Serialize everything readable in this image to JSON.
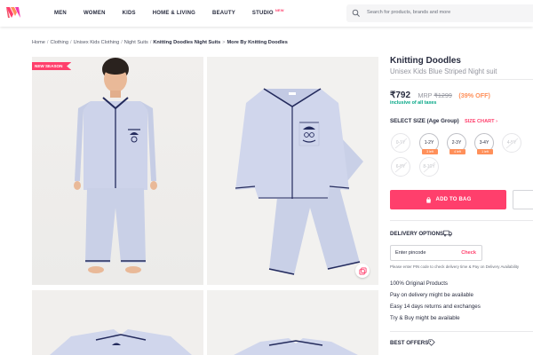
{
  "header": {
    "logo": "myntra-logo",
    "nav": [
      {
        "label": "MEN"
      },
      {
        "label": "WOMEN"
      },
      {
        "label": "KIDS"
      },
      {
        "label": "HOME & LIVING"
      },
      {
        "label": "BEAUTY"
      },
      {
        "label": "STUDIO",
        "badge": "NEW"
      }
    ],
    "search_placeholder": "Search for products, brands and more"
  },
  "breadcrumb": {
    "items": [
      "Home",
      "Clothing",
      "Unisex Kids Clothing",
      "Night Suits"
    ],
    "current": "Knitting Doodles Night Suits",
    "more": "More By Knitting Doodles"
  },
  "gallery": {
    "badge": "NEW SEASON"
  },
  "product": {
    "brand": "Knitting Doodles",
    "name": "Unisex Kids Blue Striped Night suit",
    "price": "₹792",
    "mrp_label": "MRP",
    "mrp": "₹1299",
    "discount": "(39% OFF)",
    "tax_note": "inclusive of all taxes"
  },
  "sizes": {
    "title": "SELECT SIZE (Age Group)",
    "chart_link": "SIZE CHART",
    "options": [
      {
        "label": "0-1Y",
        "available": false,
        "left": ""
      },
      {
        "label": "1-2Y",
        "available": true,
        "left": "3 left"
      },
      {
        "label": "2-3Y",
        "available": true,
        "left": "4 left"
      },
      {
        "label": "3-4Y",
        "available": true,
        "left": "1 left"
      },
      {
        "label": "4-5Y",
        "available": false,
        "left": ""
      },
      {
        "label": "5-6Y",
        "available": false,
        "left": ""
      },
      {
        "label": "6-8Y",
        "available": false,
        "left": ""
      },
      {
        "label": "8-10Y",
        "available": false,
        "left": ""
      }
    ]
  },
  "actions": {
    "add_to_bag": "ADD TO BAG"
  },
  "delivery": {
    "title": "DELIVERY OPTIONS",
    "pincode_placeholder": "Enter pincode",
    "check": "Check",
    "note": "Please enter PIN code to check delivery time & Pay on Delivery Availability",
    "features": [
      "100% Original Products",
      "Pay on delivery might be available",
      "Easy 14 days returns and exchanges",
      "Try & Buy might be available"
    ]
  },
  "offers": {
    "title": "BEST OFFERS"
  },
  "colors": {
    "brand_pink": "#ff3f6c",
    "discount_orange": "#ff905a",
    "tax_green": "#03a685",
    "garment_blue": "#cdd3ea",
    "piping_navy": "#232a5c"
  }
}
